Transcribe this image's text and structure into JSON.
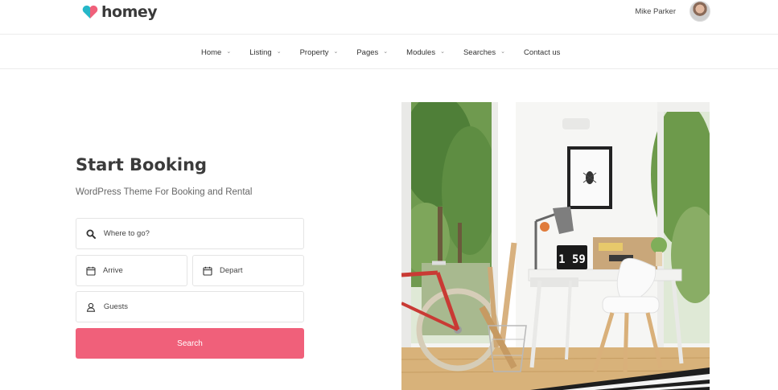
{
  "header": {
    "logo_text": "homey",
    "user_name": "Mike Parker"
  },
  "nav": {
    "items": [
      {
        "label": "Home",
        "has_dropdown": true
      },
      {
        "label": "Listing",
        "has_dropdown": true
      },
      {
        "label": "Property",
        "has_dropdown": true
      },
      {
        "label": "Pages",
        "has_dropdown": true
      },
      {
        "label": "Modules",
        "has_dropdown": true
      },
      {
        "label": "Searches",
        "has_dropdown": true
      },
      {
        "label": "Contact us",
        "has_dropdown": false
      }
    ]
  },
  "hero": {
    "title": "Start Booking",
    "subtitle": "WordPress Theme For Booking and Rental"
  },
  "search_form": {
    "where_placeholder": "Where to go?",
    "arrive_placeholder": "Arrive",
    "depart_placeholder": "Depart",
    "guests_placeholder": "Guests",
    "submit_label": "Search"
  },
  "photo": {
    "clock_text": "1 59"
  },
  "colors": {
    "brand": "#f0607a",
    "text_dark": "#3b3b3b",
    "border": "#e4e4e4"
  }
}
